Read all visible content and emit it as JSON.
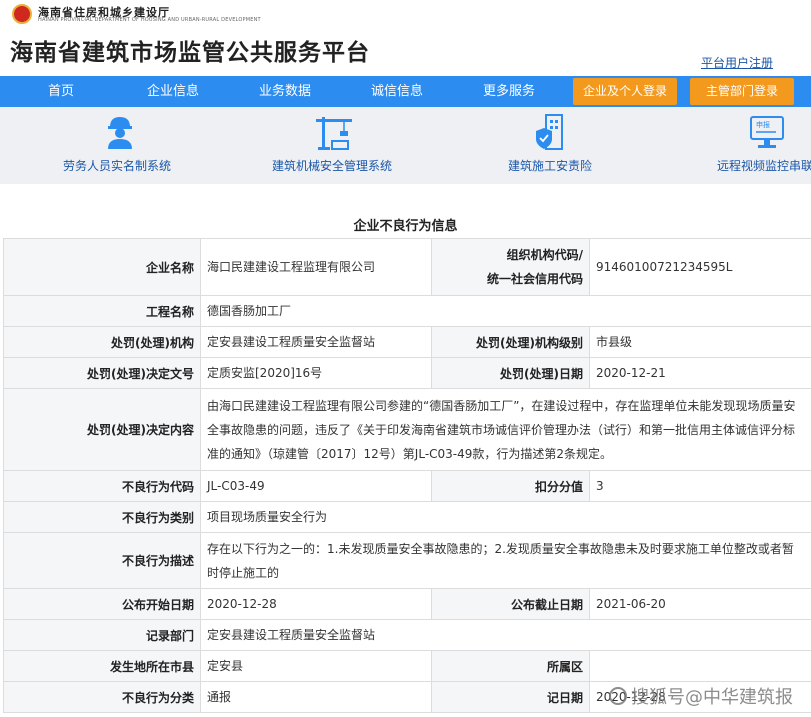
{
  "header": {
    "dept_name": "海南省住房和城乡建设厅",
    "dept_name_en": "HAINAN PROVINCIAL DEPARTMENT OF HOUSING AND URBAN-RURAL DEVELOPMENT",
    "site_title": "海南省建筑市场监管公共服务平台",
    "register_link": "平台用户注册"
  },
  "nav": {
    "items": [
      "首页",
      "企业信息",
      "业务数据",
      "诚信信息",
      "更多服务"
    ],
    "login_enterprise": "企业及个人登录",
    "login_admin": "主管部门登录"
  },
  "systems": [
    {
      "label": "劳务人员实名制系统",
      "icon": "worker-icon"
    },
    {
      "label": "建筑机械安全管理系统",
      "icon": "crane-icon"
    },
    {
      "label": "建筑施工安责险",
      "icon": "insurance-building-icon"
    },
    {
      "label": "远程视频监控串联",
      "icon": "monitor-icon"
    }
  ],
  "record": {
    "section_title": "企业不良行为信息",
    "labels": {
      "company_name": "企业名称",
      "org_code_line1": "组织机构代码/",
      "org_code_line2": "统一社会信用代码",
      "project_name": "工程名称",
      "penalty_agency": "处罚(处理)机构",
      "penalty_level": "处罚(处理)机构级别",
      "decision_no": "处罚(处理)决定文号",
      "penalty_date": "处罚(处理)日期",
      "decision_content": "处罚(处理)决定内容",
      "behavior_code": "不良行为代码",
      "deduction": "扣分分值",
      "behavior_category": "不良行为类别",
      "behavior_desc": "不良行为描述",
      "publish_start": "公布开始日期",
      "publish_end": "公布截止日期",
      "record_dept": "记录部门",
      "location_city": "发生地所在市县",
      "district": "所属区",
      "behavior_class": "不良行为分类",
      "record_date": "记日期"
    },
    "values": {
      "company_name": "海口民建建设工程监理有限公司",
      "org_code": "91460100721234595L",
      "project_name": "德国香肠加工厂",
      "penalty_agency": "定安县建设工程质量安全监督站",
      "penalty_level": "市县级",
      "decision_no": "定质安监[2020]16号",
      "penalty_date": "2020-12-21",
      "decision_content": "由海口民建建设工程监理有限公司参建的“德国香肠加工厂”，在建设过程中，存在监理单位未能发现现场质量安全事故隐患的问题，违反了《关于印发海南省建筑市场诚信评价管理办法（试行）和第一批信用主体诚信评分标准的通知》（琼建管〔2017〕12号）第JL-C03-49款，行为描述第2条规定。",
      "behavior_code": "JL-C03-49",
      "deduction": "3",
      "behavior_category": "项目现场质量安全行为",
      "behavior_desc": "存在以下行为之一的：1.未发现质量安全事故隐患的；2.发现质量安全事故隐患未及时要求施工单位整改或者暂时停止施工的",
      "publish_start": "2020-12-28",
      "publish_end": "2021-06-20",
      "record_dept": "定安县建设工程质量安全监督站",
      "location_city": "定安县",
      "district": "",
      "behavior_class": "通报",
      "record_date": "2020-12-28"
    }
  },
  "watermark": {
    "text": "搜狐号@中华建筑报"
  },
  "colors": {
    "nav_blue": "#2d8cf0",
    "login_orange": "#f39a1e",
    "link_blue": "#1b56a8",
    "band_gray": "#eef0f3"
  }
}
